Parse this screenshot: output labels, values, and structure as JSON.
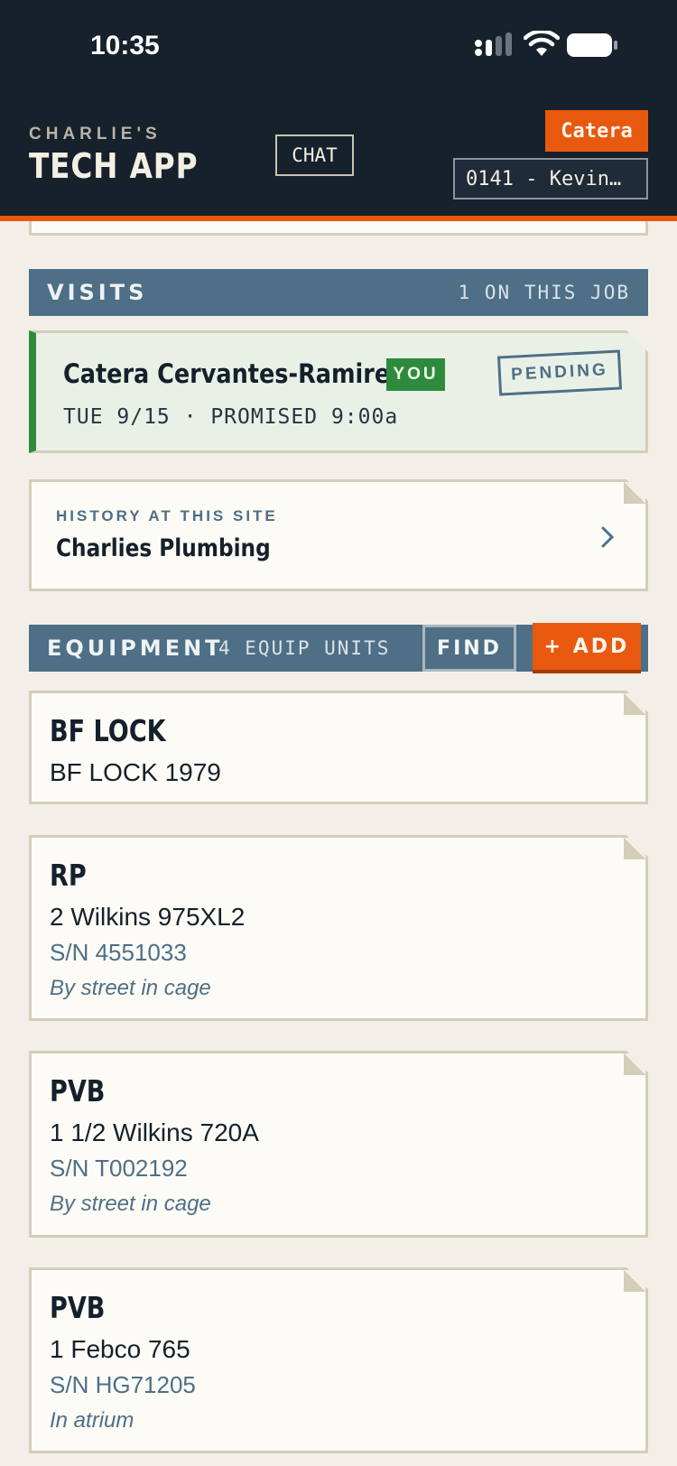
{
  "status_bar": {
    "time": "10:35"
  },
  "header": {
    "brand_top": "CHARLIE'S",
    "brand_main": "TECH APP",
    "chat_label": "CHAT",
    "user_name": "Catera",
    "job_selector": "0141 - Kevin…",
    "accent_color": "#e8590f"
  },
  "visits": {
    "title": "VISITS",
    "count_label": "1 ON THIS JOB",
    "items": [
      {
        "tech_name": "Catera Cervantes-Ramirez",
        "you_badge": "YOU",
        "status": "PENDING",
        "when": "TUE 9/15 · PROMISED 9:00a"
      }
    ]
  },
  "history": {
    "label": "HISTORY AT THIS SITE",
    "company": "Charlies Plumbing",
    "icon": "chevron-right-icon"
  },
  "equipment": {
    "title": "EQUIPMENT",
    "count_label": "4 EQUIP UNITS",
    "find_label": "FIND",
    "add_label": "+ ADD",
    "items": [
      {
        "type": "BF LOCK",
        "model": "BF LOCK 1979",
        "serial": "",
        "location": ""
      },
      {
        "type": "RP",
        "model": "2 Wilkins 975XL2",
        "serial": "S/N 4551033",
        "location": "By street in cage"
      },
      {
        "type": "PVB",
        "model": "1 1/2 Wilkins 720A",
        "serial": "S/N T002192",
        "location": "By street in cage"
      },
      {
        "type": "PVB",
        "model": "1 Febco 765",
        "serial": "S/N HG71205",
        "location": "In atrium"
      }
    ]
  }
}
